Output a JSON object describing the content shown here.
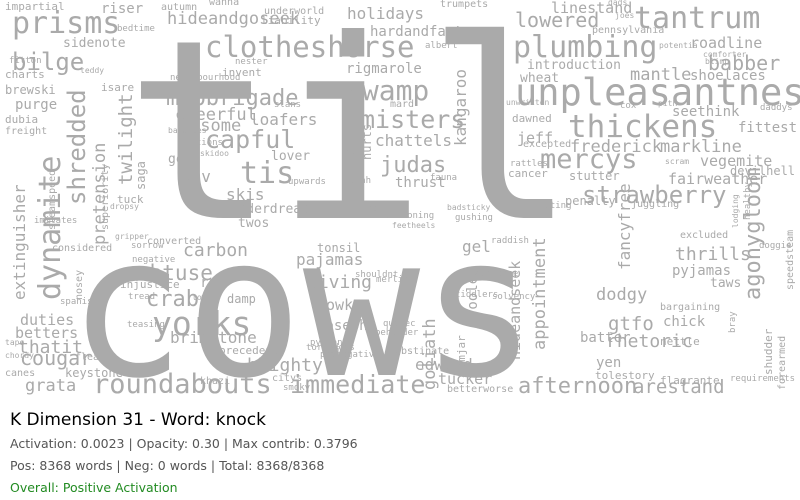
{
  "wordcloud": {
    "word_color": "#aaaaaa",
    "words": [
      "cows",
      "til",
      "unpleasantness",
      "plumbing",
      "clotheshorse",
      "tantrum",
      "prisms",
      "agonygloom",
      "dynamite",
      "swamp",
      "yorks",
      "roundabouts",
      "strawberry",
      "shredded",
      "mercys",
      "thickens",
      "immediate",
      "afternoon",
      "mobbrigade",
      "tis",
      "capful",
      "obtuse",
      "crabs",
      "judas",
      "misters",
      "bilge",
      "hideandgoseek",
      "lowered",
      "babber",
      "pretension",
      "extinguisher",
      "cougar",
      "appointment",
      "diving",
      "carbon",
      "gtfo",
      "thrills",
      "rhetoric",
      "goliath",
      "hideandseek",
      "arestand",
      "roadline",
      "mantle",
      "frederick",
      "markline",
      "vegemite",
      "fairweather",
      "linestand",
      "holidays",
      "rigmarole",
      "hardandfast",
      "chattels",
      "skis",
      "twilight",
      "cheerful",
      "asome",
      "loafers",
      "sav",
      "gown",
      "lover",
      "thrust",
      "jeff",
      "seethink",
      "shoelaces",
      "fittest",
      "duties",
      "thatit",
      "grata",
      "betters",
      "brimstone",
      "blighty",
      "edward",
      "tucker",
      "yen",
      "batter",
      "chick",
      "dodgy",
      "pyjamas",
      "taws",
      "pajamas",
      "joseph",
      "gowk",
      "tonsil",
      "rec",
      "damp",
      "fancyfree",
      "fooled",
      "gel",
      "kangaroo",
      "stuffe",
      "hurts",
      "jamjar",
      "riser",
      "sidenote",
      "purge",
      "brewski",
      "dubia",
      "charts",
      "impartial",
      "isare",
      "fitton",
      "introduction",
      "wheat",
      "pennsylvania",
      "nester",
      "invent",
      "slans",
      "liability",
      "underworld",
      "autumn",
      "wanna",
      "keystone",
      "precedent",
      "khazi",
      "citys",
      "obstinate",
      "stutter",
      "cancer",
      "dawned",
      "excepted",
      "shudderdread",
      "twos",
      "tuck",
      "injustice",
      "nosey",
      "considered",
      "steamspeed",
      "superiority",
      "converted",
      "saga",
      "trumpets",
      "albert",
      "bedtime",
      "teddy",
      "freight",
      "forearmed",
      "shudder",
      "speedsteam",
      "devilhell",
      "excluded",
      "flagrante",
      "requirements",
      "nettle",
      "bargaining",
      "penalty",
      "juggling",
      "voting",
      "lodging",
      "tolestory",
      "betterworse",
      "tiddlers",
      "sorbonne",
      "solvency",
      "merlin",
      "quebec",
      "kiln",
      "smoky",
      "canes",
      "fleas",
      "upwards",
      "neighbourhood",
      "balances",
      "rations",
      "skidoo",
      "imitates",
      "shouldnt",
      "torpedoes",
      "prerogative",
      "beholder",
      "sorrow",
      "negative",
      "tread",
      "teasing",
      "spanish",
      "louie",
      "judah",
      "mard",
      "python",
      "mentioning",
      "frock",
      "badsticky",
      "gushing",
      "raddish",
      "feetheels",
      "fauna",
      "dads",
      "joes",
      "unwritten",
      "daddys",
      "cox",
      "pith",
      "potentia",
      "comforter",
      "blimp",
      "rattles",
      "scram",
      "healthy",
      "doggie",
      "bray",
      "dropsy",
      "gripper",
      "tape",
      "chordy",
      "trumpet",
      "eugene",
      "handsome",
      "sorry",
      "spatial"
    ],
    "big": [
      "cows",
      "til"
    ]
  },
  "info": {
    "title": "K Dimension 31 - Word: knock",
    "line1": "Activation: 0.0023 | Opacity: 0.30 | Max contrib: 0.3796",
    "line2": "Pos: 8368 words | Neg: 0 words | Total: 8368/8368",
    "status": "Overall: Positive Activation",
    "status_color": "#228b22"
  }
}
